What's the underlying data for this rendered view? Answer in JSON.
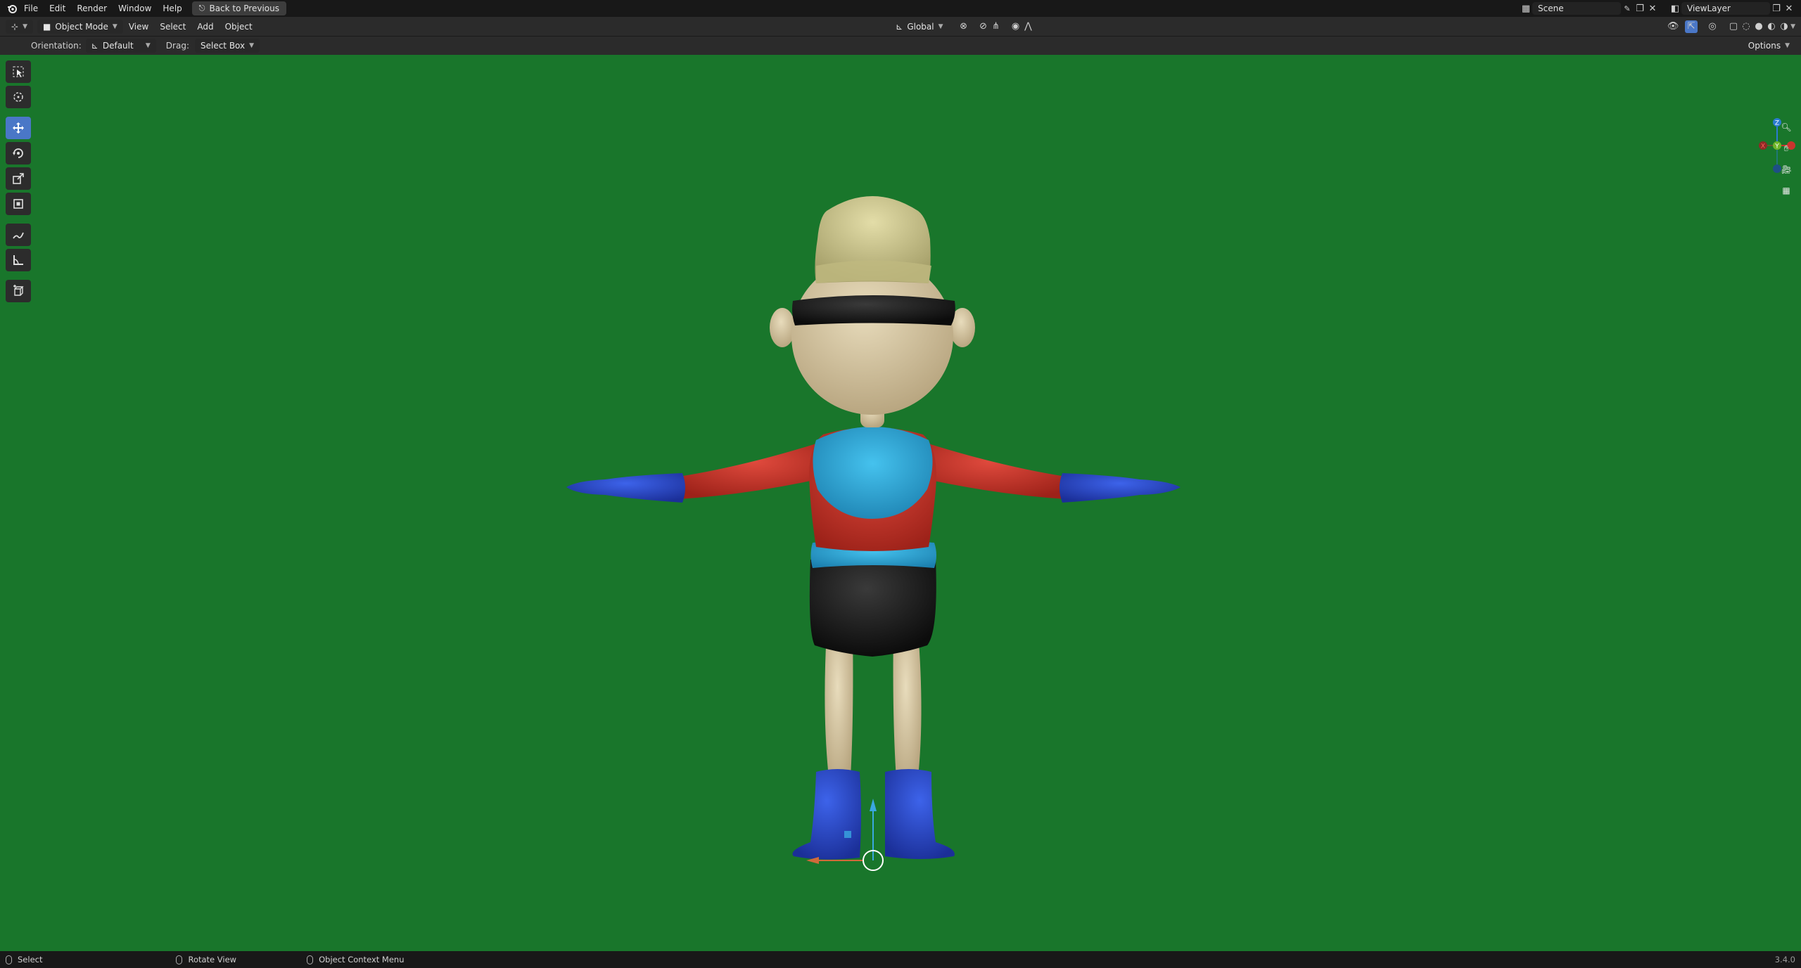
{
  "topbar": {
    "menus": [
      "File",
      "Edit",
      "Render",
      "Window",
      "Help"
    ],
    "back_button": "Back to Previous",
    "scene_name": "Scene",
    "view_layer_name": "ViewLayer"
  },
  "header": {
    "mode": "Object Mode",
    "menus": [
      "View",
      "Select",
      "Add",
      "Object"
    ],
    "transform_orientation": "Global"
  },
  "tool_settings": {
    "orientation_label": "Orientation:",
    "orientation_value": "Default",
    "drag_label": "Drag:",
    "drag_value": "Select Box",
    "options_label": "Options"
  },
  "toolbar": {
    "tools": [
      "select-box",
      "cursor",
      "move",
      "rotate",
      "scale",
      "transform",
      "annotate",
      "measure",
      "add-cube"
    ],
    "active_tool": "move"
  },
  "gizmo": {
    "x_label": "X",
    "y_label": "Y",
    "z_label": "Z"
  },
  "statusbar": {
    "left_action": "Select",
    "middle_action": "Rotate View",
    "right_action": "Object Context Menu",
    "version": "3.4.0"
  },
  "colors": {
    "viewport_bg": "#19762b",
    "active_tool": "#4a77c7",
    "skin": "#d9c9a4",
    "shirt": "#c8332a",
    "vest": "#2aa7d6",
    "gloves_boots": "#2746c9",
    "shorts": "#151515",
    "hat": "#cfc98f"
  }
}
